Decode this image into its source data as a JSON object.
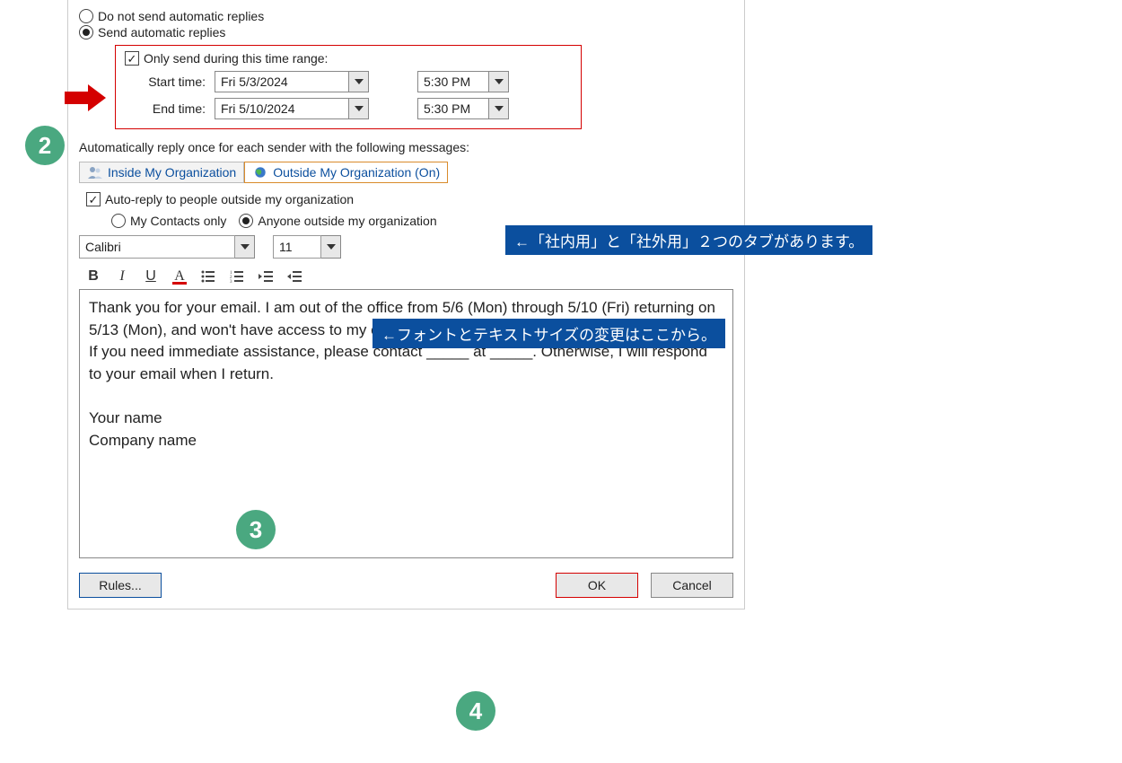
{
  "radios": {
    "doNotSend": "Do not send automatic replies",
    "sendAuto": "Send automatic replies"
  },
  "timeRange": {
    "onlySendLabel": "Only send during this time range:",
    "startLabel": "Start time:",
    "endLabel": "End time:",
    "startDate": "Fri 5/3/2024",
    "startTime": "5:30 PM",
    "endDate": "Fri 5/10/2024",
    "endTime": "5:30 PM"
  },
  "sectionLabel": "Automatically reply once for each sender with the following messages:",
  "tabs": {
    "inside": "Inside My Organization",
    "outside": "Outside My Organization (On)"
  },
  "autoReplyOutside": "Auto-reply to people outside my organization",
  "contactsOnly": "My Contacts only",
  "anyoneOutside": "Anyone outside my organization",
  "font": {
    "name": "Calibri",
    "size": "11"
  },
  "messageBody": "Thank you for your email. I am out of the office from 5/6 (Mon) through 5/10 (Fri) returning on 5/13 (Mon), and won't have access to my email.\nIf you need immediate assistance, please contact _____ at _____. Otherwise, I will respond to your email when I return.\n\nYour name\nCompany name",
  "buttons": {
    "rules": "Rules...",
    "ok": "OK",
    "cancel": "Cancel"
  },
  "annotations": {
    "step2": "2",
    "step3": "3",
    "step4": "4",
    "tabsNote": "←「社内用」と「社外用」２つのタブがあります。",
    "fontNote": "←フォントとテキストサイズの変更はここから。"
  }
}
